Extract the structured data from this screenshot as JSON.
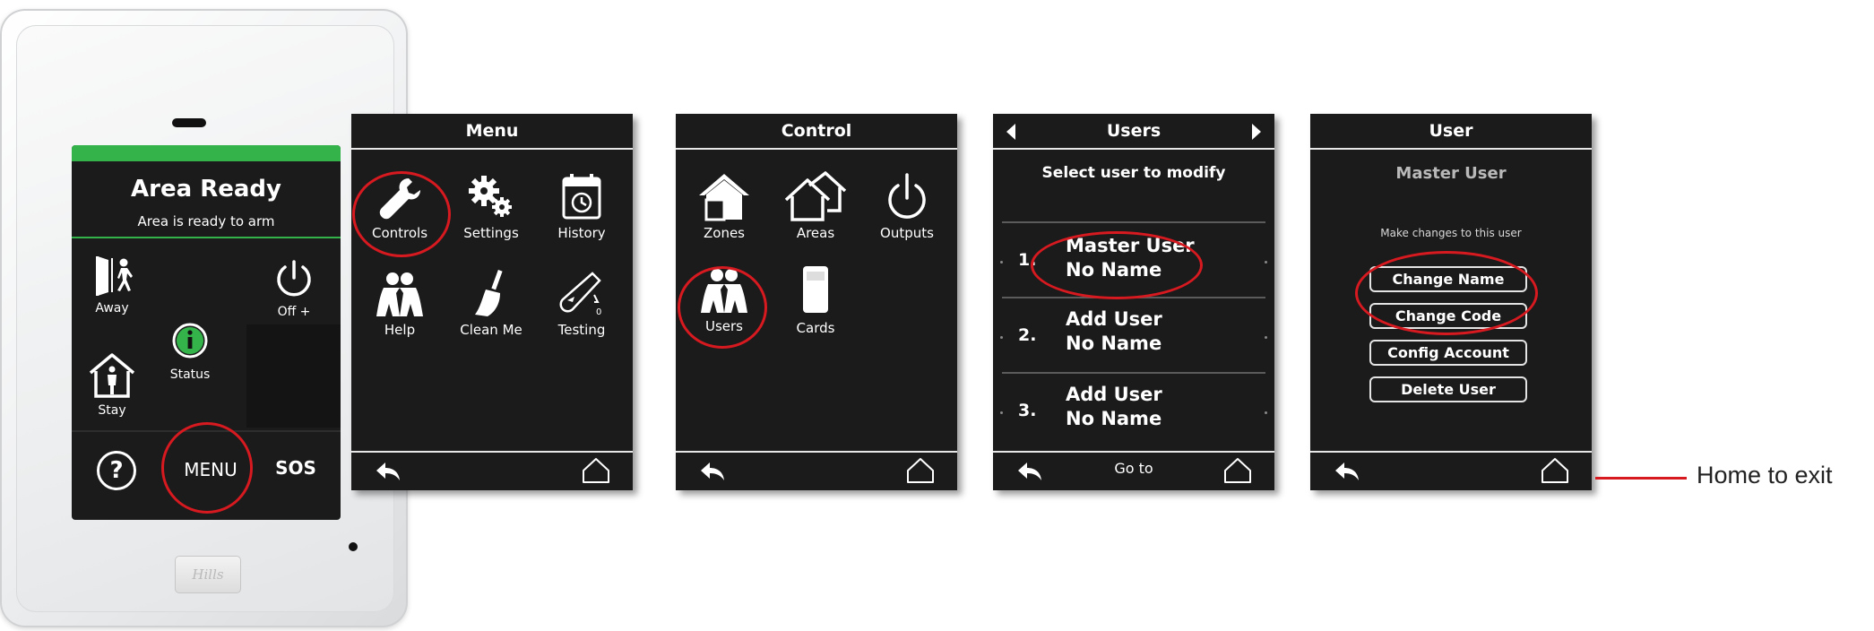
{
  "keypad": {
    "title": "Area Ready",
    "subtitle": "Area is ready to arm",
    "away_label": "Away",
    "off_label": "Off +",
    "status_label": "Status",
    "stay_label": "Stay",
    "help_symbol": "?",
    "menu_label": "MENU",
    "sos_label": "SOS",
    "brand": "Hills",
    "accent_color": "#33b34a"
  },
  "menu_panel": {
    "title": "Menu",
    "items": [
      {
        "label": "Controls",
        "icon": "wrench-icon"
      },
      {
        "label": "Settings",
        "icon": "gears-icon"
      },
      {
        "label": "History",
        "icon": "history-icon"
      },
      {
        "label": "Help",
        "icon": "help-people-icon"
      },
      {
        "label": "Clean Me",
        "icon": "broom-icon"
      },
      {
        "label": "Testing",
        "icon": "test-tube-icon"
      }
    ]
  },
  "control_panel": {
    "title": "Control",
    "items": [
      {
        "label": "Zones",
        "icon": "zones-house-icon"
      },
      {
        "label": "Areas",
        "icon": "areas-houses-icon"
      },
      {
        "label": "Outputs",
        "icon": "power-icon"
      },
      {
        "label": "Users",
        "icon": "users-icon"
      },
      {
        "label": "Cards",
        "icon": "card-icon"
      }
    ]
  },
  "users_panel": {
    "title": "Users",
    "subtitle": "Select user to modify",
    "rows": [
      {
        "num": "1.",
        "line1": "Master User",
        "line2": "No Name"
      },
      {
        "num": "2.",
        "line1": "Add User",
        "line2": "No Name"
      },
      {
        "num": "3.",
        "line1": "Add User",
        "line2": "No Name"
      }
    ],
    "footer_label": "Go to"
  },
  "user_panel": {
    "title": "User",
    "subtitle": "Master User",
    "instruction": "Make changes to this user",
    "buttons": [
      "Change Name",
      "Change Code",
      "Config Account",
      "Delete User"
    ]
  },
  "callout": {
    "text": "Home to exit",
    "highlight_color": "#d71920"
  }
}
